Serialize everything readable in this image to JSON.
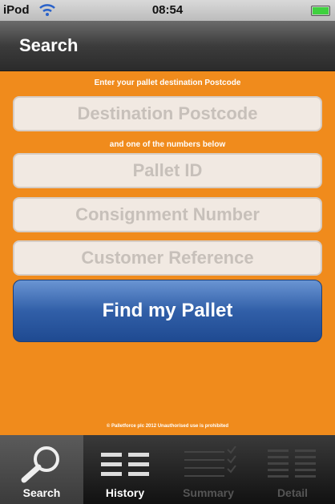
{
  "status": {
    "carrier": "iPod",
    "time": "08:54"
  },
  "nav": {
    "title": "Search"
  },
  "form": {
    "hint_top": "Enter your pallet destination Postcode",
    "hint_mid": "and one of the numbers below",
    "postcode_placeholder": "Destination Postcode",
    "pallet_placeholder": "Pallet ID",
    "consignment_placeholder": "Consignment Number",
    "reference_placeholder": "Customer Reference",
    "find_label": "Find my Pallet",
    "copyright": "© Palletforce plc 2012 Unauthorised use is prohibited"
  },
  "tabs": [
    {
      "label": "Search",
      "icon": "search-icon"
    },
    {
      "label": "History",
      "icon": "history-icon"
    },
    {
      "label": "Summary",
      "icon": "summary-icon"
    },
    {
      "label": "Detail",
      "icon": "detail-icon"
    }
  ],
  "colors": {
    "background": "#f08b1c",
    "button": "#315fa8"
  }
}
